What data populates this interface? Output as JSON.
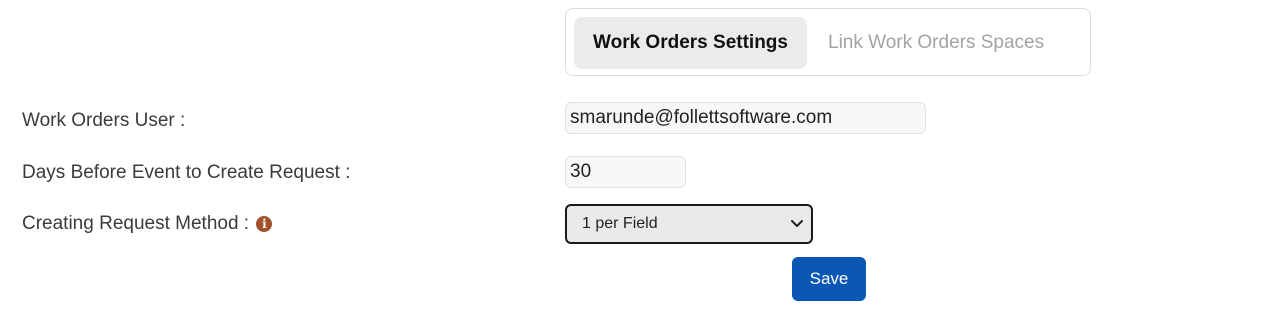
{
  "tabs": [
    {
      "label": "Work Orders Settings",
      "active": true
    },
    {
      "label": "Link Work Orders Spaces",
      "active": false
    }
  ],
  "form": {
    "user_label": "Work Orders User :",
    "user_value": "smarunde@follettsoftware.com",
    "days_label": "Days Before Event to Create Request :",
    "days_value": "30",
    "method_label": "Creating Request Method :",
    "method_info_icon": "info-circle-icon",
    "method_value": "1 per Field",
    "save_label": "Save"
  },
  "colors": {
    "save_button": "#0b57b5",
    "info_icon": "#a0522d",
    "active_tab_bg": "#ebebeb",
    "inactive_tab_text": "#a3a3a3"
  }
}
